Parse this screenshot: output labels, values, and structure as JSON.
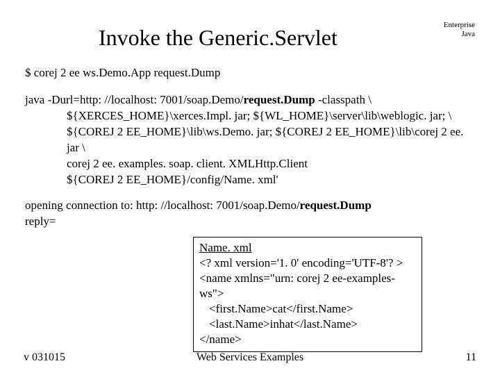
{
  "header": {
    "title": "Invoke the Generic.Servlet",
    "corner": "Enterprise\nJava"
  },
  "cmd": {
    "prompt": "$ corej 2 ee ws.Demo.App request.Dump"
  },
  "invocation": {
    "line1_pre": "java -Durl=http: //localhost: 7001/soap.Demo/",
    "line1_bold": "request.Dump",
    "line1_post": " -classpath \\",
    "line2": "${XERCES_HOME}\\xerces.Impl. jar; ${WL_HOME}\\server\\lib\\weblogic. jar; \\",
    "line3": "${COREJ 2 EE_HOME}\\lib\\ws.Demo. jar; ${COREJ 2 EE_HOME}\\lib\\corej 2 ee. jar \\",
    "line4": "corej 2 ee. examples. soap. client. XMLHttp.Client",
    "line5": "${COREJ 2 EE_HOME}/config/Name. xml'"
  },
  "output": {
    "line1_pre": "opening connection to: http: //localhost: 7001/soap.Demo/",
    "line1_bold": "request.Dump",
    "line2": "reply="
  },
  "xmlbox": {
    "title": "Name. xml",
    "l1": "<? xml version='1. 0' encoding='UTF-8'? >",
    "l2": "<name xmlns=\"urn: corej 2 ee-examples-ws\">",
    "l3": "<first.Name>cat</first.Name>",
    "l4": "<last.Name>inhat</last.Name>",
    "l5": "</name>"
  },
  "footer": {
    "left": "v 031015",
    "center": "Web Services Examples",
    "right": "11"
  }
}
